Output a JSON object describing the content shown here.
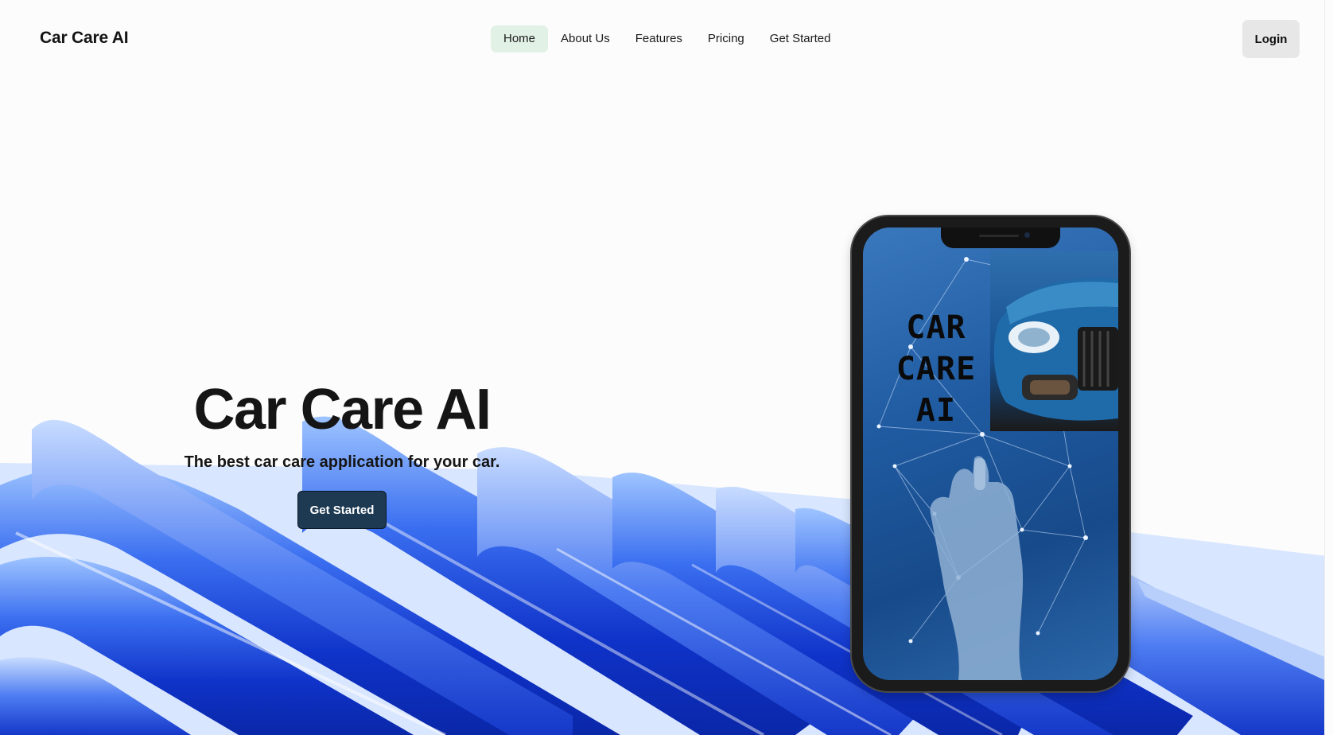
{
  "header": {
    "brand": "Car Care AI",
    "nav": [
      {
        "label": "Home",
        "active": true
      },
      {
        "label": "About Us",
        "active": false
      },
      {
        "label": "Features",
        "active": false
      },
      {
        "label": "Pricing",
        "active": false
      },
      {
        "label": "Get Started",
        "active": false
      }
    ],
    "login_label": "Login"
  },
  "hero": {
    "title": "Car Care AI",
    "subtitle": "The best car care application for your car.",
    "cta_label": "Get Started"
  },
  "phone": {
    "logo_line1": "CAR",
    "logo_line2": "CARE",
    "logo_line3": "AI"
  },
  "colors": {
    "accent_active": "#e2f1e6",
    "cta_bg": "#1e3a52",
    "wave_blue": "#1a45d6"
  }
}
